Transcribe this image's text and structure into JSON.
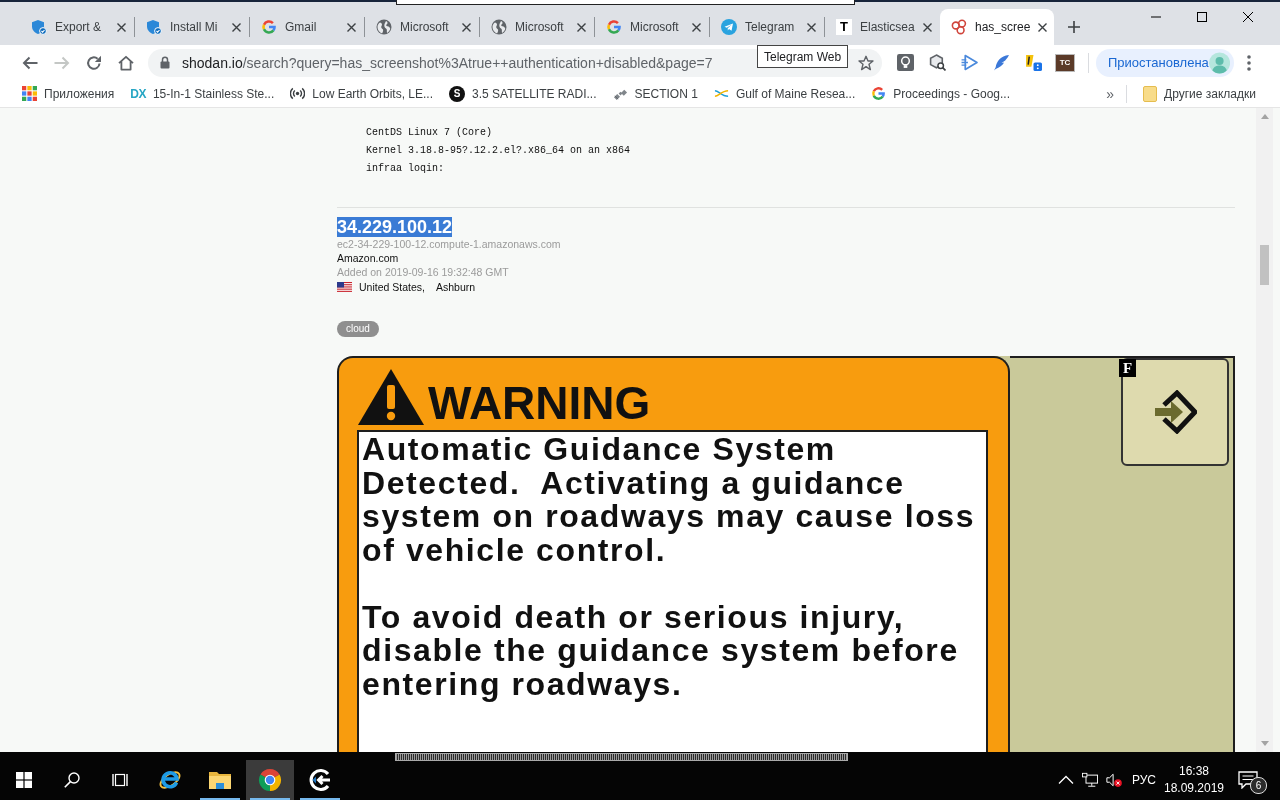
{
  "tabs": [
    {
      "title": "Export &",
      "kind": "shield",
      "selected": false
    },
    {
      "title": "Install Mi",
      "kind": "shield",
      "selected": false
    },
    {
      "title": "Gmail",
      "kind": "google",
      "selected": false
    },
    {
      "title": "Microsoft",
      "kind": "globe",
      "selected": false
    },
    {
      "title": "Microsoft",
      "kind": "globe",
      "selected": false
    },
    {
      "title": "Microsoft",
      "kind": "google",
      "selected": false
    },
    {
      "title": "Telegram",
      "kind": "telegram",
      "selected": false
    },
    {
      "title": "Elasticsea",
      "kind": "letter",
      "icon_text": "T",
      "selected": false
    },
    {
      "title": "has_scree",
      "kind": "rings",
      "selected": true
    }
  ],
  "toolbar": {
    "nav": [
      {
        "kind": "back",
        "disabled": false
      },
      {
        "kind": "forward",
        "disabled": true
      },
      {
        "kind": "reload",
        "disabled": false
      },
      {
        "kind": "home",
        "disabled": false
      }
    ],
    "url": {
      "host": "shodan.io",
      "path": "/search?query=has_screenshot%3Atrue++authentication+disabled&page=7"
    },
    "tooltip": "Telegram Web",
    "extensions": [
      {
        "kind": "bulb"
      },
      {
        "kind": "magnifier"
      },
      {
        "kind": "play"
      },
      {
        "kind": "feather"
      },
      {
        "kind": "badge"
      },
      {
        "kind": "letters",
        "text": "TC"
      }
    ],
    "profile": "Приостановлена"
  },
  "bookmarks": {
    "items": [
      {
        "kind": "apps",
        "label": "Приложения"
      },
      {
        "kind": "letters",
        "icon_text": "DX",
        "label": "15-In-1 Stainless Ste..."
      },
      {
        "kind": "radio",
        "label": "Low Earth Orbits, LE..."
      },
      {
        "kind": "circle_letter",
        "icon_text": "S",
        "label": "3.5 SATELLITE RADI..."
      },
      {
        "kind": "satellite",
        "label": "SECTION 1"
      },
      {
        "kind": "wave",
        "label": "Gulf of Maine Resea..."
      },
      {
        "kind": "google",
        "label": "Proceedings - Goog..."
      }
    ],
    "overflow": "»",
    "other": "Другие закладки"
  },
  "result": {
    "banner": [
      "CentDS Linux 7 (Core)",
      "Kernel 3.18.8-95?.12.2.el?.x86_64 on an x864",
      "infraa loqin:"
    ],
    "ip": "34.229.100.12",
    "ip_selected": true,
    "hostname": "ec2-34-229-100-12.compute-1.amazonaws.com",
    "org": "Amazon.com",
    "added": "Added on 2019-09-16 19:32:48 GMT",
    "country": "United States,",
    "city": "Ashburn",
    "tags": [
      "cloud"
    ],
    "screenshot": {
      "heading": "WARNING",
      "paragraphs": [
        "Automatic Guidance System Detected.  Activating a guidance system on roadways may cause loss of vehicle control.",
        "To avoid death or serious injury, disable the guidance system before entering roadways."
      ],
      "key_label": "F"
    }
  },
  "taskbar": {
    "apps": [
      {
        "kind": "ie",
        "running": false,
        "selected": false
      },
      {
        "kind": "explorer",
        "running": true,
        "selected": false
      },
      {
        "kind": "chrome",
        "running": true,
        "selected": true
      },
      {
        "kind": "app",
        "running": true,
        "selected": false
      }
    ],
    "tray": {
      "volume_muted": true,
      "language": "РУС",
      "time": "16:38",
      "date": "18.09.2019",
      "notifications": "6"
    }
  }
}
